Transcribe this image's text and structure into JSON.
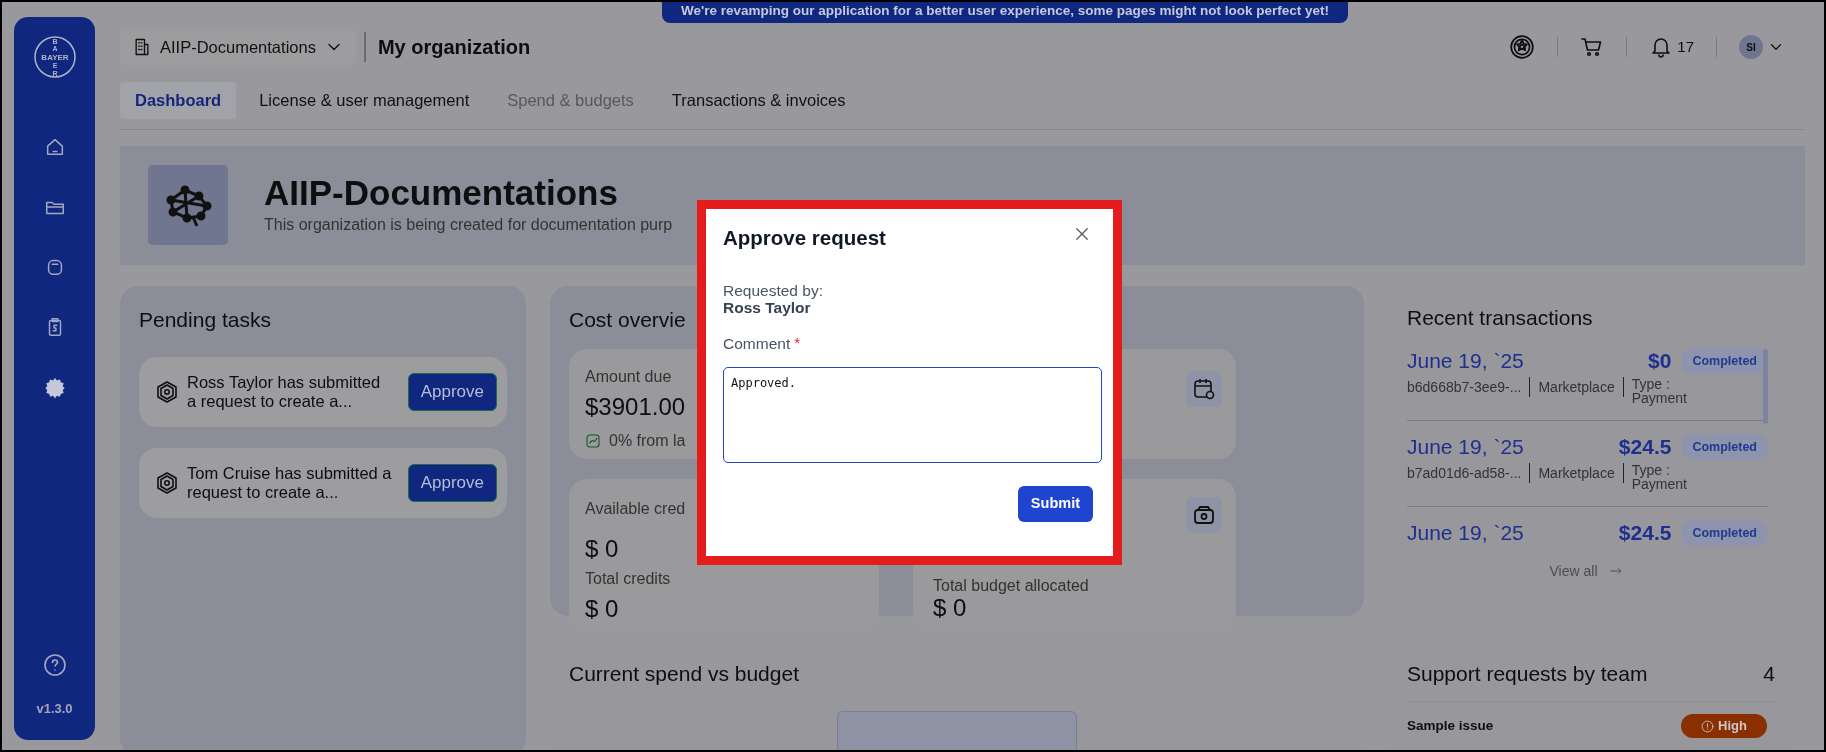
{
  "banner": "We're revamping our application for a better user experience, some pages might not look perfect yet!",
  "sidebar": {
    "logo": {
      "top": "BA",
      "middle": "BAYER",
      "bottom": "ER"
    },
    "items": [
      {
        "selected": false
      },
      {
        "selected": false
      },
      {
        "selected": false
      },
      {
        "selected": false
      },
      {
        "selected": true
      }
    ],
    "version": "v1.3.0"
  },
  "header": {
    "org_select": "AIIP-Documentations",
    "page_title": "My organization",
    "notifications": "17",
    "avatar": "SI"
  },
  "tabs": [
    {
      "label": "Dashboard",
      "selected": true,
      "disabled": false
    },
    {
      "label": "License & user management",
      "selected": false,
      "disabled": false
    },
    {
      "label": "Spend & budgets",
      "selected": false,
      "disabled": true
    },
    {
      "label": "Transactions & invoices",
      "selected": false,
      "disabled": false
    }
  ],
  "organization": {
    "name": "AIIP-Documentations",
    "description": "This organization is being created for documentation purp"
  },
  "pending_tasks": {
    "title": "Pending tasks",
    "tasks": [
      {
        "text": "Ross Taylor has submitted a request to create a...",
        "button": "Approve"
      },
      {
        "text": "Tom Cruise has submitted a request to create a...",
        "button": "Approve"
      }
    ]
  },
  "cost_overview": {
    "title": "Cost overvie",
    "amount_label": "Amount due",
    "amount": "$3901.00",
    "trend": "0% from la",
    "credits_label": "Available cred",
    "credits": "$ 0",
    "total_credits_label": "Total credits",
    "total_credits": "$ 0",
    "budget_label": "Total budget allocated",
    "budget": "$ 0"
  },
  "current_spend": {
    "title": "Current spend vs budget"
  },
  "recent_transactions": {
    "title": "Recent transactions",
    "items": [
      {
        "date": "June 19, `25",
        "amount": "$0",
        "status": "Completed",
        "id": "b6d668b7-3ee9-...",
        "source": "Marketplace",
        "type": "Type : Payment"
      },
      {
        "date": "June 19, `25",
        "amount": "$24.5",
        "status": "Completed",
        "id": "b7ad01d6-ad58-...",
        "source": "Marketplace",
        "type": "Type : Payment"
      },
      {
        "date": "June 19, `25",
        "amount": "$24.5",
        "status": "Completed"
      }
    ],
    "view_all": "View all"
  },
  "support_requests": {
    "title": "Support requests by team",
    "count": "4",
    "items": [
      {
        "title": "Sample issue",
        "priority": "High"
      }
    ]
  },
  "modal": {
    "title": "Approve request",
    "requested_by_label": "Requested by:",
    "requested_by": "Ross Taylor",
    "comment_label": "Comment",
    "required_mark": "*",
    "comment": "Approved.",
    "submit": "Submit"
  }
}
